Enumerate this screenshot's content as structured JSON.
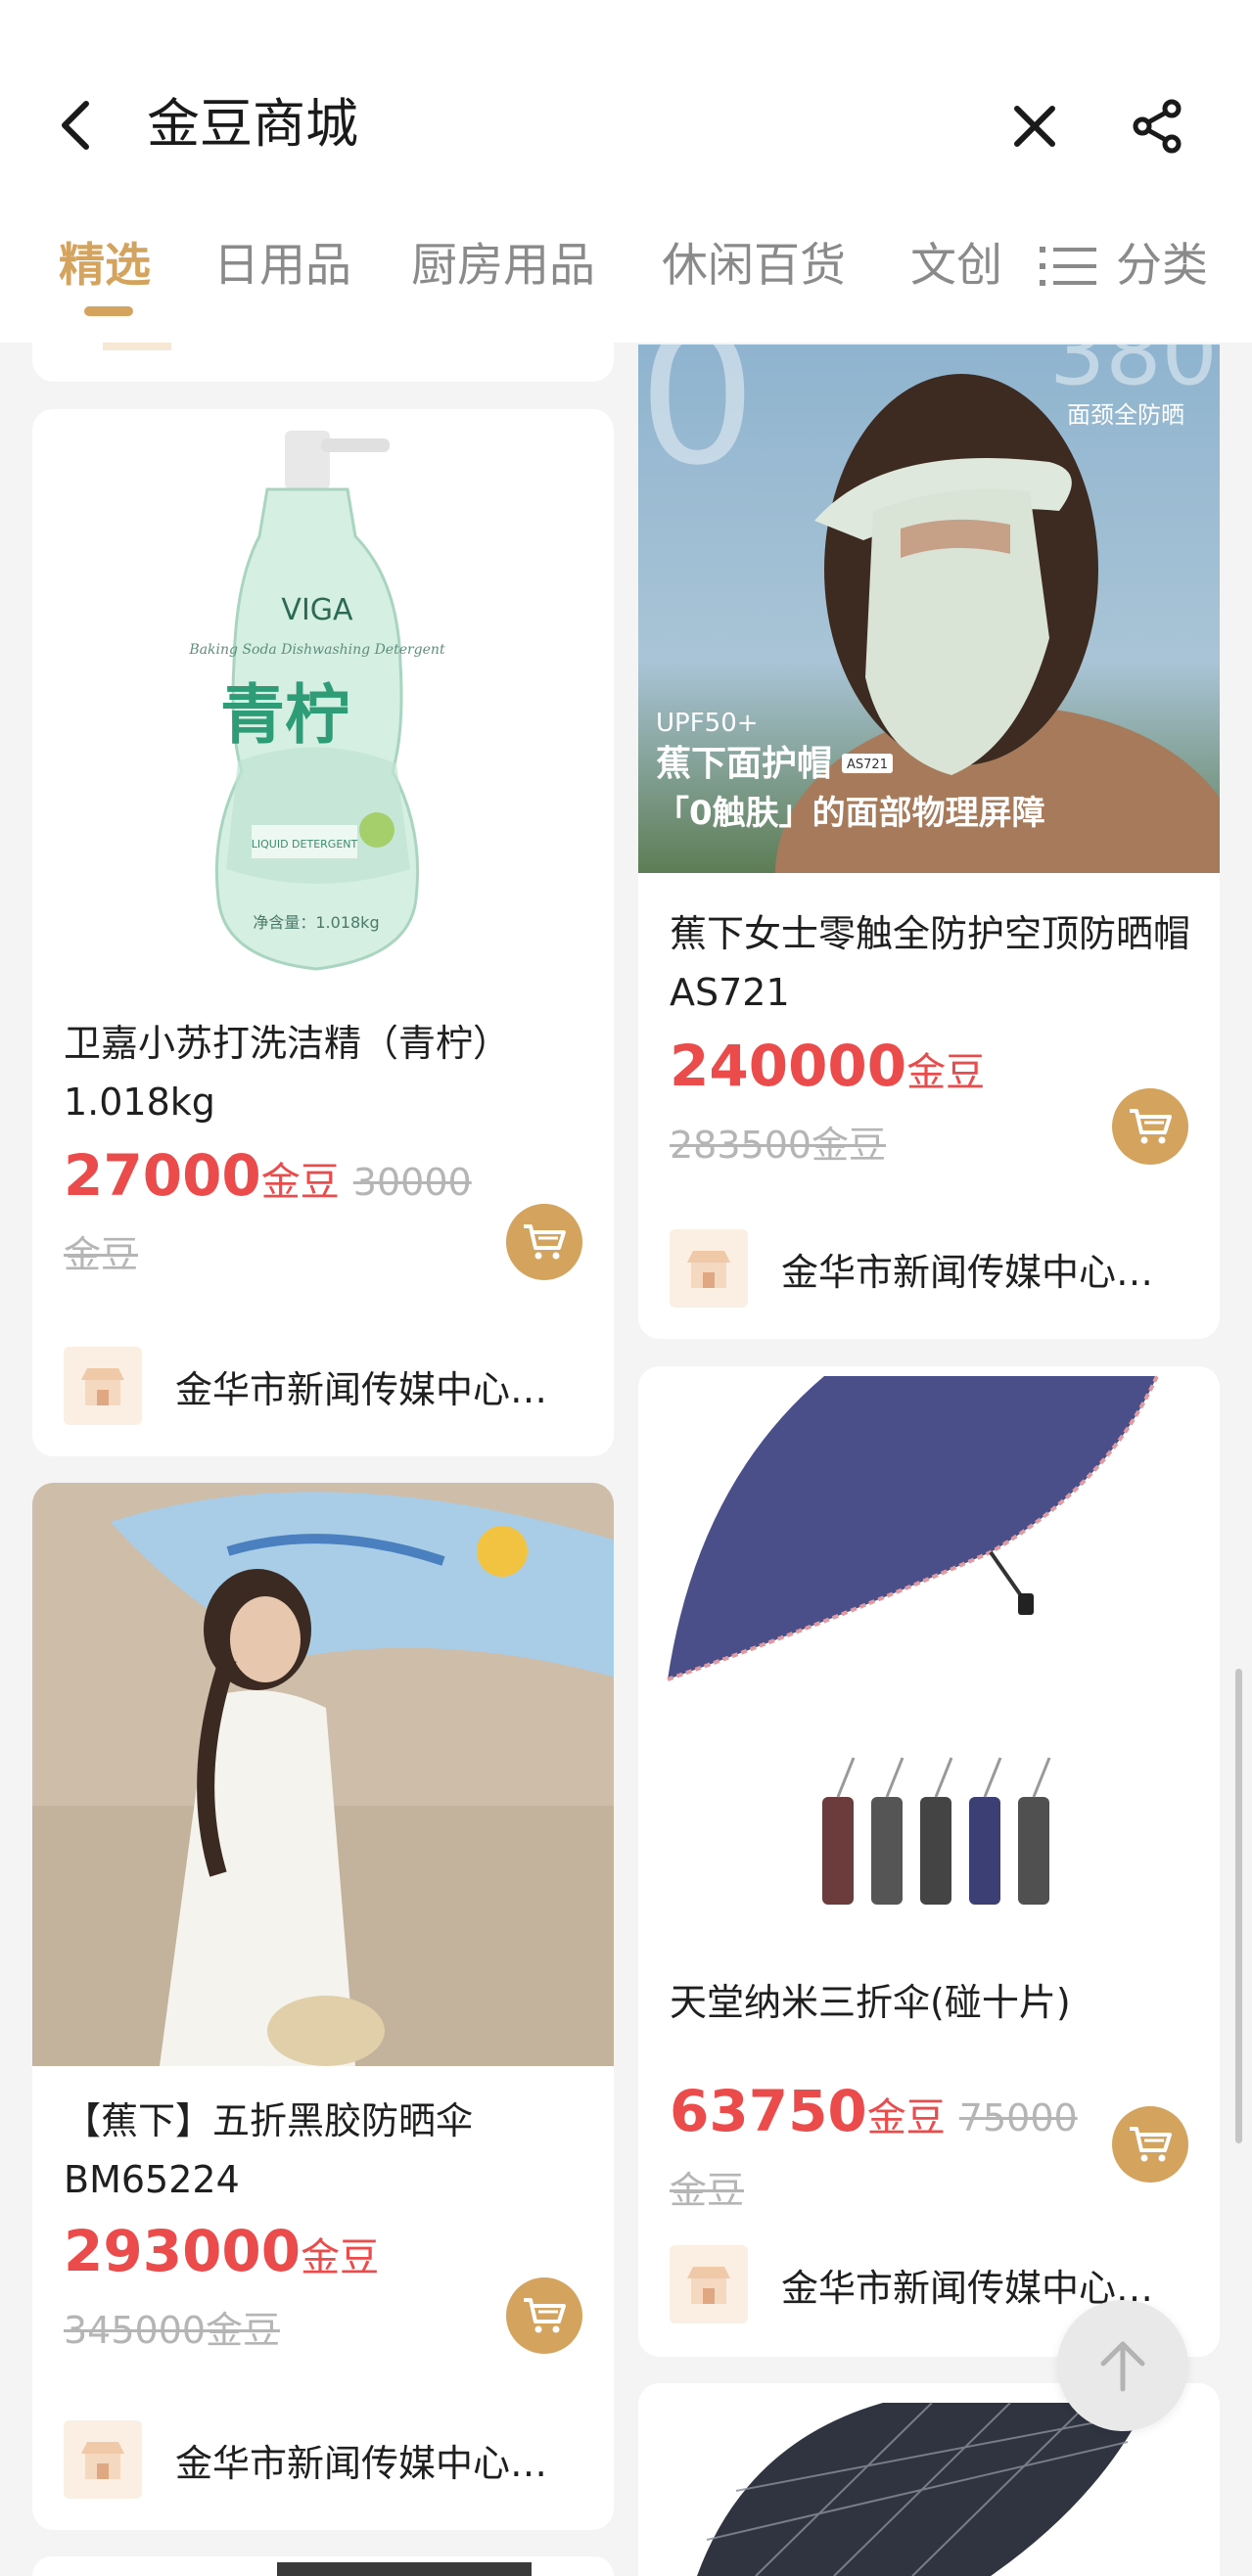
{
  "header": {
    "title": "金豆商城",
    "back_icon": "chevron-left-icon",
    "close_icon": "close-icon",
    "share_icon": "share-icon"
  },
  "tabs": [
    {
      "label": "精选",
      "active": true
    },
    {
      "label": "日用品",
      "active": false
    },
    {
      "label": "厨房用品",
      "active": false
    },
    {
      "label": "休闲百货",
      "active": false
    },
    {
      "label": "文创",
      "active": false
    }
  ],
  "category_label": "分类",
  "colors": {
    "accent": "#d4a35e",
    "price": "#ec4b4b",
    "muted": "#b5b5b5",
    "background": "#f4f4f4"
  },
  "products": [
    {
      "name": "卫嘉小苏打洗洁精（青柠）1.018kg",
      "price": "27000",
      "unit": "金豆",
      "original_price": "30000金豆",
      "store": "金华市新闻传媒中心…",
      "image_text": {
        "brand": "VIGA",
        "big": "青柠",
        "sub": "Baking Soda Dishwashing Detergent",
        "badge": "LIQUID DETERGENT",
        "net": "净含量：1.018kg"
      }
    },
    {
      "name": "蕉下女士零触全防护空顶防晒帽AS721",
      "price": "240000",
      "unit": "金豆",
      "original_price": "283500金豆",
      "store": "金华市新闻传媒中心…",
      "image_text": {
        "top_right": "面颈全防晒",
        "upf": "UPF50+",
        "headline": "蕉下面护帽",
        "model": "AS721",
        "tagline": "「0触肤」的面部物理屏障"
      }
    },
    {
      "name": "【蕉下】五折黑胶防晒伞BM65224",
      "price": "293000",
      "unit": "金豆",
      "original_price": "345000金豆",
      "store": "金华市新闻传媒中心…"
    },
    {
      "name": "天堂纳米三折伞(碰十片)",
      "price": "63750",
      "unit": "金豆",
      "original_price": "75000金豆",
      "store": "金华市新闻传媒中心…"
    }
  ]
}
